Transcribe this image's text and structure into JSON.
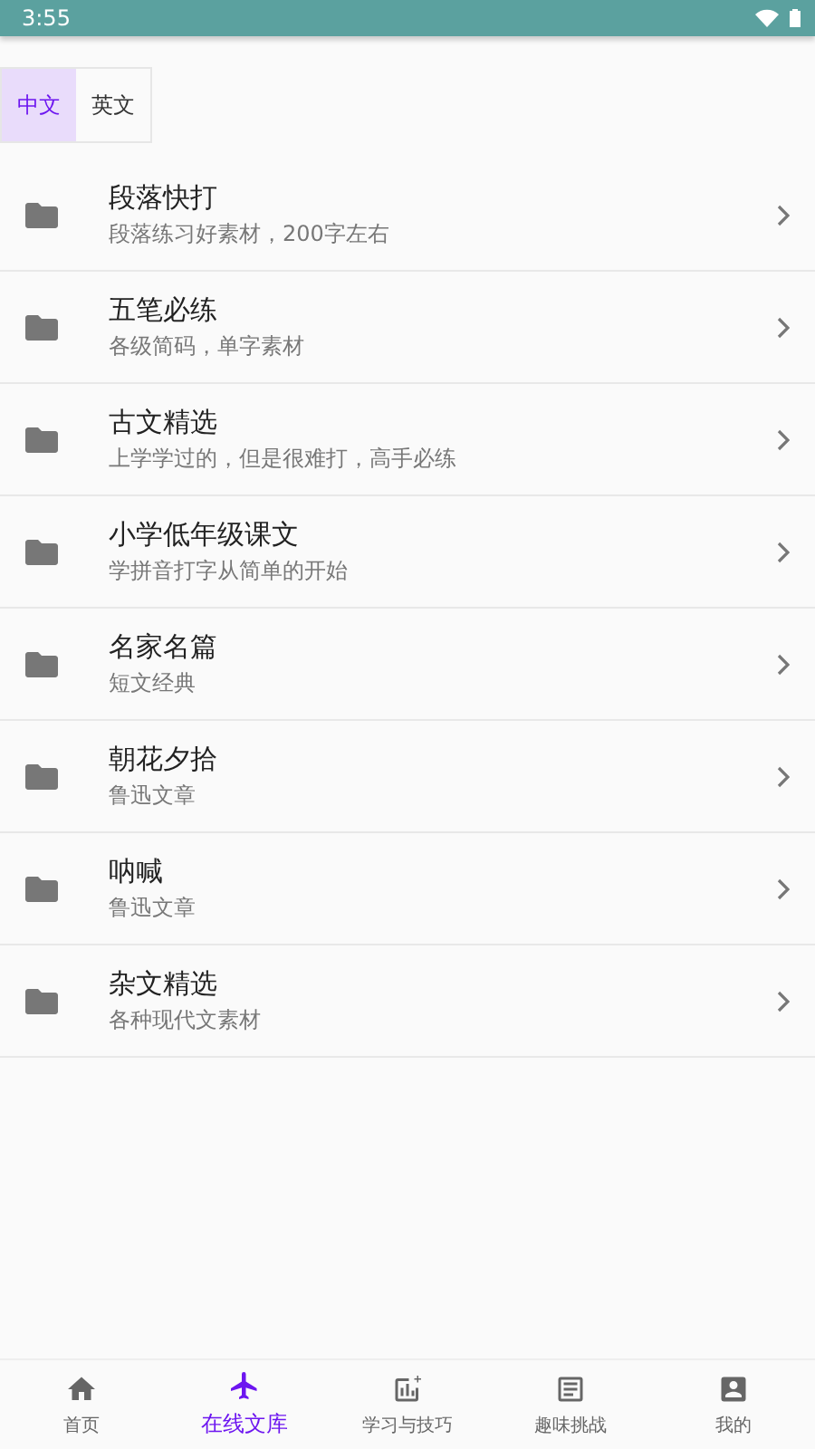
{
  "status_bar": {
    "time": "3:55"
  },
  "tabs": [
    {
      "label": "中文",
      "selected": true
    },
    {
      "label": "英文",
      "selected": false
    }
  ],
  "items": [
    {
      "title": "段落快打",
      "subtitle": "段落练习好素材，200字左右"
    },
    {
      "title": "五笔必练",
      "subtitle": "各级简码，单字素材"
    },
    {
      "title": "古文精选",
      "subtitle": "上学学过的，但是很难打，高手必练"
    },
    {
      "title": "小学低年级课文",
      "subtitle": "学拼音打字从简单的开始"
    },
    {
      "title": "名家名篇",
      "subtitle": "短文经典"
    },
    {
      "title": "朝花夕拾",
      "subtitle": "鲁迅文章"
    },
    {
      "title": "呐喊",
      "subtitle": "鲁迅文章"
    },
    {
      "title": "杂文精选",
      "subtitle": "各种现代文素材"
    }
  ],
  "bottom_nav": [
    {
      "kind": "home",
      "label": "首页",
      "selected": false
    },
    {
      "kind": "plane",
      "label": "在线文库",
      "selected": true
    },
    {
      "kind": "chart",
      "label": "学习与技巧",
      "selected": false
    },
    {
      "kind": "article",
      "label": "趣味挑战",
      "selected": false
    },
    {
      "kind": "account",
      "label": "我的",
      "selected": false
    }
  ]
}
